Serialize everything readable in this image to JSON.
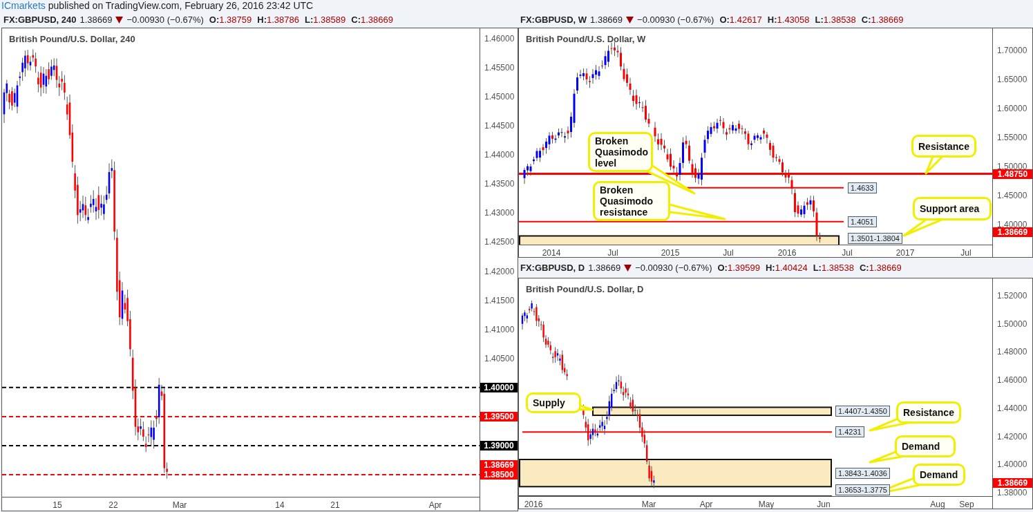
{
  "byline": {
    "author": "ICmarkets",
    "text": "published on TradingView.com, February 26, 2016 23:42 UTC"
  },
  "panels": [
    {
      "symbol": "FX:GBPUSD, 240",
      "last": "1.38669",
      "change": "−0.00930 (−0.67%)",
      "ohlc": [
        {
          "key": "O:",
          "value": "1.38759"
        },
        {
          "key": "H:",
          "value": "1.38786"
        },
        {
          "key": "L:",
          "value": "1.38589"
        },
        {
          "key": "C:",
          "value": "1.38669"
        }
      ],
      "title": "British Pound/U.S. Dollar, 240",
      "price_ticks": [
        "1.46000",
        "1.45500",
        "1.45000",
        "1.44500",
        "1.44000",
        "1.43500",
        "1.43000",
        "1.42500",
        "1.42000",
        "1.41500",
        "1.41000",
        "1.40500"
      ],
      "time_ticks": [
        "15",
        "22",
        "Mar",
        "14",
        "21",
        "Apr"
      ],
      "levels": [
        {
          "kind": "axis",
          "label": "1.40000",
          "color": "#000000"
        },
        {
          "kind": "axis",
          "label": "1.39500",
          "color": "#ff0000"
        },
        {
          "kind": "axis",
          "label": "1.39000",
          "color": "#000000"
        },
        {
          "kind": "axis",
          "label": "1.38500",
          "color": "#ff0000"
        }
      ],
      "price_marker": {
        "label": "1.38669",
        "color": "#ff0000"
      }
    },
    {
      "symbol": "FX:GBPUSD, W",
      "last": "1.38669",
      "change": "−0.00930 (−0.67%)",
      "ohlc": [
        {
          "key": "O:",
          "value": "1.42617"
        },
        {
          "key": "H:",
          "value": "1.43058"
        },
        {
          "key": "L:",
          "value": "1.38538"
        },
        {
          "key": "C:",
          "value": "1.38669"
        }
      ],
      "title": "British Pound/U.S. Dollar, W",
      "price_ticks": [
        "1.70000",
        "1.65000",
        "1.60000",
        "1.55000",
        "1.50000",
        "1.45000",
        "1.40000"
      ],
      "time_ticks": [
        "2014",
        "Jul",
        "2015",
        "Jul",
        "2016",
        "Jul",
        "2017",
        "Jul"
      ],
      "levels": [
        {
          "kind": "axis",
          "label": "1.48750",
          "color": "#ff0000"
        },
        {
          "kind": "boxed",
          "label": "1.4633"
        },
        {
          "kind": "boxed",
          "label": "1.4051"
        },
        {
          "kind": "zone",
          "label": "1.3501-1.3804"
        }
      ],
      "price_marker": {
        "label": "1.38669",
        "color": "#ff0000"
      },
      "callouts": [
        {
          "text": "Broken Quasimodo level"
        },
        {
          "text": "Broken Quasimodo resistance"
        },
        {
          "text": "Resistance"
        },
        {
          "text": "Support area"
        }
      ]
    },
    {
      "symbol": "FX:GBPUSD, D",
      "last": "1.38669",
      "change": "−0.00930 (−0.67%)",
      "ohlc": [
        {
          "key": "O:",
          "value": "1.39599"
        },
        {
          "key": "H:",
          "value": "1.40424"
        },
        {
          "key": "L:",
          "value": "1.38538"
        },
        {
          "key": "C:",
          "value": "1.38669"
        }
      ],
      "title": "British Pound/U.S. Dollar, D",
      "price_ticks": [
        "1.52000",
        "1.50000",
        "1.48000",
        "1.46000",
        "1.44000",
        "1.42000",
        "1.40000",
        "1.38000"
      ],
      "time_ticks": [
        "2016",
        "Mar",
        "Apr",
        "May",
        "Jun",
        "Aug",
        "Sep"
      ],
      "levels": [
        {
          "kind": "zone",
          "label": "1.4407-1.4350"
        },
        {
          "kind": "boxed",
          "label": "1.4231"
        },
        {
          "kind": "zone",
          "label": "1.3843-1.4036"
        },
        {
          "kind": "zone",
          "label": "1.3653-1.3775"
        }
      ],
      "price_marker": {
        "label": "1.38669",
        "color": "#ff0000"
      },
      "callouts": [
        {
          "text": "Supply"
        },
        {
          "text": "Resistance"
        },
        {
          "text": "Demand"
        },
        {
          "text": "Demand"
        }
      ]
    }
  ]
}
